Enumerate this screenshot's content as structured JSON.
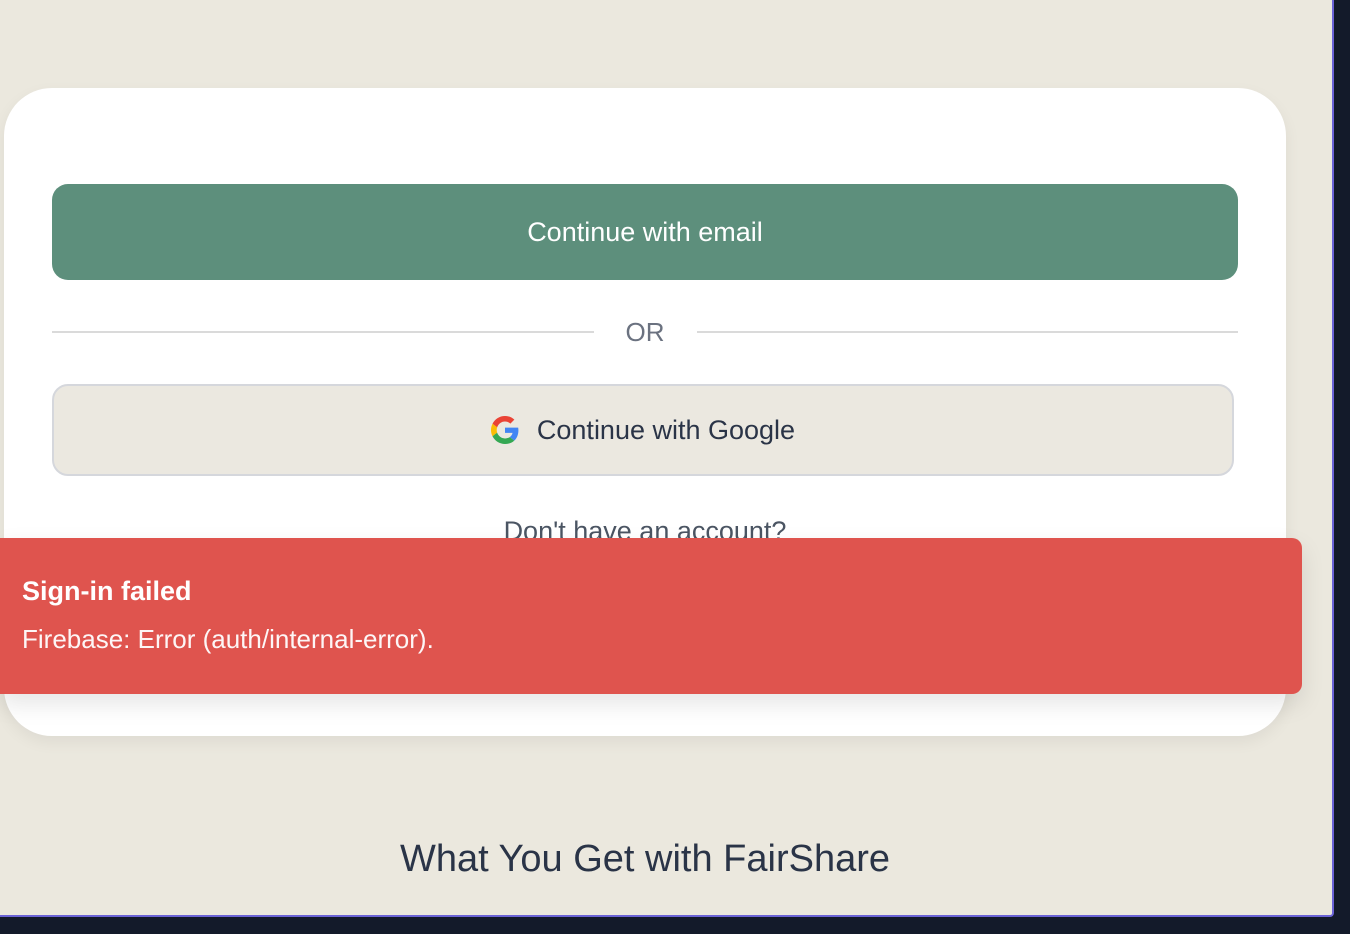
{
  "auth": {
    "email_button_label": "Continue with email",
    "divider_label": "OR",
    "google_button_label": "Continue with Google",
    "signup_prompt": "Don't have an account?"
  },
  "toast": {
    "title": "Sign-in failed",
    "message": "Firebase: Error (auth/internal-error)."
  },
  "features": {
    "heading": "What You Get with FairShare"
  },
  "colors": {
    "primary": "#5d8f7c",
    "background": "#ebe8de",
    "error": "#df544e",
    "text_dark": "#2a3447"
  },
  "icons": {
    "google": "google-g-logo-icon"
  }
}
